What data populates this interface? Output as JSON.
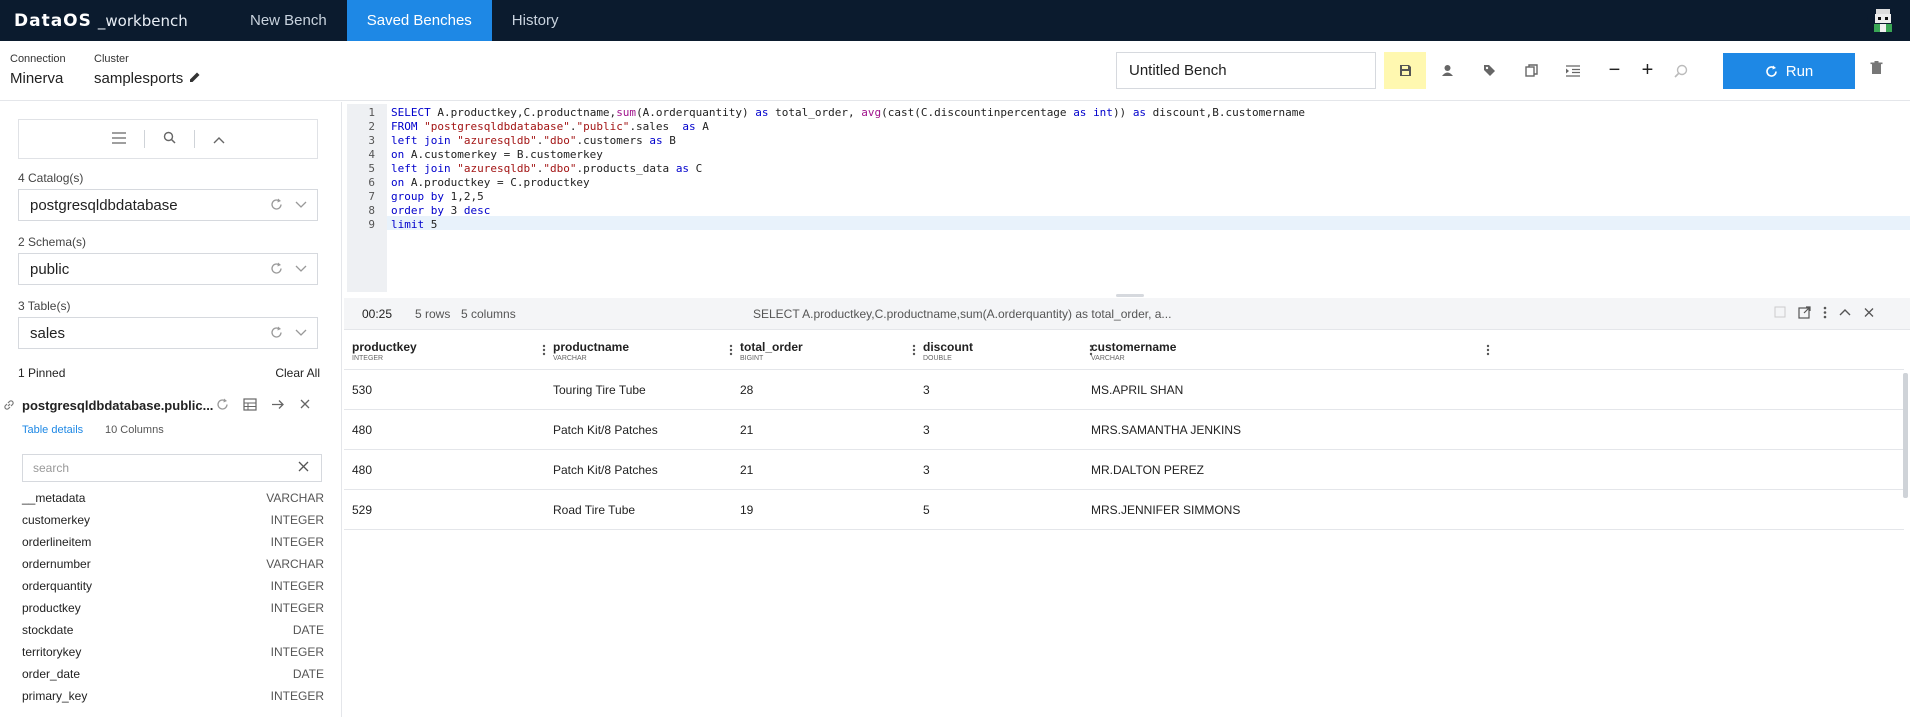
{
  "app": {
    "brand": "DataOS",
    "product": "_workbench",
    "nav_tabs": [
      {
        "label": "New Bench",
        "active": false
      },
      {
        "label": "Saved Benches",
        "active": true
      },
      {
        "label": "History",
        "active": false
      }
    ],
    "accent_color": "#1e88e5",
    "nav_bg": "#0b1b2e"
  },
  "header": {
    "connection_label": "Connection",
    "connection_value": "Minerva",
    "cluster_label": "Cluster",
    "cluster_value": "samplesports",
    "bench_name": "Untitled Bench",
    "run_label": "Run",
    "zoom_out": "−",
    "zoom_in": "+",
    "toolbar_icons": [
      "save-icon",
      "user-icon",
      "tag-icon",
      "copy-icon",
      "indent-icon"
    ]
  },
  "sidebar": {
    "catalog_label": "4 Catalog(s)",
    "catalog_value": "postgresqldbdatabase",
    "schema_label": "2 Schema(s)",
    "schema_value": "public",
    "table_label": "3 Table(s)",
    "table_value": "sales",
    "pinned_label": "1 Pinned",
    "clear_all": "Clear All",
    "pinned_table": "postgresqldbdatabase.public...",
    "table_details": "Table details",
    "column_count": "10 Columns",
    "column_search_placeholder": "search",
    "columns": [
      {
        "name": "__metadata",
        "type": "VARCHAR"
      },
      {
        "name": "customerkey",
        "type": "INTEGER"
      },
      {
        "name": "orderlineitem",
        "type": "INTEGER"
      },
      {
        "name": "ordernumber",
        "type": "VARCHAR"
      },
      {
        "name": "orderquantity",
        "type": "INTEGER"
      },
      {
        "name": "productkey",
        "type": "INTEGER"
      },
      {
        "name": "stockdate",
        "type": "DATE"
      },
      {
        "name": "territorykey",
        "type": "INTEGER"
      },
      {
        "name": "order_date",
        "type": "DATE"
      },
      {
        "name": "primary_key",
        "type": "INTEGER"
      }
    ]
  },
  "editor": {
    "line_numbers": [
      "1",
      "2",
      "3",
      "4",
      "5",
      "6",
      "7",
      "8",
      "9"
    ],
    "lines": [
      [
        [
          "k",
          "SELECT"
        ],
        [
          "t",
          " A.productkey,C.productname,"
        ],
        [
          "f",
          "sum"
        ],
        [
          "t",
          "(A.orderquantity) "
        ],
        [
          "k",
          "as"
        ],
        [
          "t",
          " total_order, "
        ],
        [
          "f",
          "avg"
        ],
        [
          "t",
          "(cast(C.discountinpercentage "
        ],
        [
          "k",
          "as"
        ],
        [
          "t",
          " "
        ],
        [
          "k",
          "int"
        ],
        [
          "t",
          ")) "
        ],
        [
          "k",
          "as"
        ],
        [
          "t",
          " discount,B.customername"
        ]
      ],
      [
        [
          "k",
          "FROM"
        ],
        [
          "t",
          " "
        ],
        [
          "s",
          "\"postgresqldbdatabase\""
        ],
        [
          "t",
          "."
        ],
        [
          "s",
          "\"public\""
        ],
        [
          "t",
          ".sales  "
        ],
        [
          "k",
          "as"
        ],
        [
          "t",
          " A"
        ]
      ],
      [
        [
          "k",
          "left join"
        ],
        [
          "t",
          " "
        ],
        [
          "s",
          "\"azuresqldb\""
        ],
        [
          "t",
          "."
        ],
        [
          "s",
          "\"dbo\""
        ],
        [
          "t",
          ".customers "
        ],
        [
          "k",
          "as"
        ],
        [
          "t",
          " B"
        ]
      ],
      [
        [
          "k",
          "on"
        ],
        [
          "t",
          " A.customerkey = B.customerkey"
        ]
      ],
      [
        [
          "k",
          "left join"
        ],
        [
          "t",
          " "
        ],
        [
          "s",
          "\"azuresqldb\""
        ],
        [
          "t",
          "."
        ],
        [
          "s",
          "\"dbo\""
        ],
        [
          "t",
          ".products_data "
        ],
        [
          "k",
          "as"
        ],
        [
          "t",
          " C"
        ]
      ],
      [
        [
          "k",
          "on"
        ],
        [
          "t",
          " A.productkey = C.productkey"
        ]
      ],
      [
        [
          "k",
          "group by"
        ],
        [
          "t",
          " 1,2,5"
        ]
      ],
      [
        [
          "k",
          "order by"
        ],
        [
          "t",
          " 3 "
        ],
        [
          "k",
          "desc"
        ]
      ],
      [
        [
          "k",
          "limit"
        ],
        [
          "t",
          " 5"
        ]
      ]
    ],
    "syntax_colors": {
      "k": "#0000cc",
      "f": "#a0148c",
      "s": "#a31515",
      "t": "#222222"
    }
  },
  "results": {
    "elapsed": "00:25",
    "rows_label": "5 rows",
    "cols_label": "5 columns",
    "query_preview": "SELECT A.productkey,C.productname,sum(A.orderquantity) as total_order, a...",
    "columns": [
      {
        "name": "productkey",
        "type": "INTEGER"
      },
      {
        "name": "productname",
        "type": "VARCHAR"
      },
      {
        "name": "total_order",
        "type": "BIGINT"
      },
      {
        "name": "discount",
        "type": "DOUBLE"
      },
      {
        "name": "customername",
        "type": "VARCHAR"
      }
    ],
    "rows": [
      [
        "530",
        "Touring Tire Tube",
        "28",
        "3",
        "MS.APRIL SHAN"
      ],
      [
        "480",
        "Patch Kit/8 Patches",
        "21",
        "3",
        "MRS.SAMANTHA JENKINS"
      ],
      [
        "480",
        "Patch Kit/8 Patches",
        "21",
        "3",
        "MR.DALTON PEREZ"
      ],
      [
        "529",
        "Road Tire Tube",
        "19",
        "5",
        "MRS.JENNIFER SIMMONS"
      ]
    ]
  }
}
